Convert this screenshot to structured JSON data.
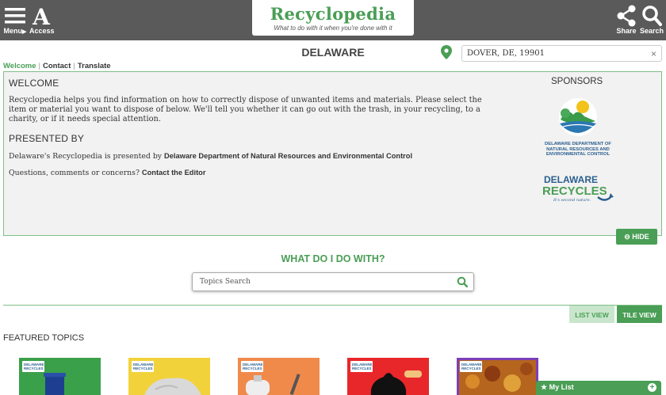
{
  "header": {
    "menu_label": "Menu",
    "access_label": "Access",
    "share_label": "Share",
    "search_label": "Search",
    "logo_title": "Recyclopedia",
    "logo_tagline": "What to do with it when you're done with it"
  },
  "location": {
    "state": "DELAWARE",
    "value": "DOVER, DE, 19901"
  },
  "tabs": [
    "Welcome",
    "Contact",
    "Translate"
  ],
  "welcome": {
    "title": "WELCOME",
    "body": "Recyclopedia helps you find information on how to correctly dispose of unwanted items and materials. Please select the item or material you want to dispose of below. We'll tell you whether it can go out with the trash, in your recycling, to a charity, or if it needs special attention.",
    "presented_title": "PRESENTED BY",
    "presented_prefix": "Delaware's Recyclopedia is presented by ",
    "presented_org": "Delaware Department of Natural Resources and Environmental Control",
    "questions_prefix": "Questions, comments or concerns? ",
    "questions_link": "Contact the Editor",
    "sponsors_title": "SPONSORS",
    "hide_label": "HIDE"
  },
  "sponsors": {
    "dnrec_text": "DELAWARE DEPARTMENT OF NATURAL RESOURCES AND ENVIRONMENTAL CONTROL",
    "drec_line1": "DELAWARE",
    "drec_line2": "RECYCLES",
    "drec_tag": "It's second nature."
  },
  "search": {
    "heading": "WHAT DO I DO WITH?",
    "placeholder": "Topics Search"
  },
  "views": {
    "list": "LIST VIEW",
    "tile": "TILE VIEW"
  },
  "featured": {
    "title": "FEATURED TOPICS",
    "badge_text": "DELAWARE RECYCLES",
    "tiles": [
      {
        "bg": "#3aa04a",
        "icon": "recycling-cart-icon"
      },
      {
        "bg": "#f2d23a",
        "icon": "rock-icon"
      },
      {
        "bg": "#f08a4b",
        "icon": "propane-tank-icon"
      },
      {
        "bg": "#e8272a",
        "icon": "trash-bag-icon"
      },
      {
        "bg": "#7d3fb8",
        "icon": "leaves-icon"
      }
    ]
  },
  "mylist": {
    "label": "My List"
  },
  "colors": {
    "brand_green": "#4a9e55",
    "topbar": "#5a5a5a"
  }
}
